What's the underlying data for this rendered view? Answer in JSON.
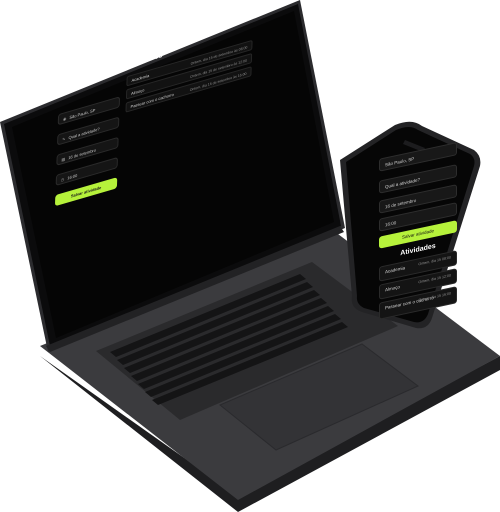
{
  "colors": {
    "accent": "#b6f23b",
    "device_body": "#3a3a3c",
    "screen": "#060606",
    "field": "#151515"
  },
  "laptop": {
    "form": {
      "location": "São Paulo, SP",
      "activity_placeholder": "Qual a atividade?",
      "date": "16 de setembro",
      "time": "16:00",
      "save_label": "Salvar atividade"
    },
    "panel": {
      "title": "Atividades",
      "items": [
        {
          "label": "Academia",
          "meta": "Ontem, dia 15 de setembro às 08:00"
        },
        {
          "label": "Almoço",
          "meta": "Ontem, dia 15 de setembro às 12:00"
        },
        {
          "label": "Passear com o cachorro",
          "meta": "Ontem, dia 15 de setembro às 16:00"
        }
      ]
    }
  },
  "phone": {
    "form": {
      "location": "São Paulo, SP",
      "activity_placeholder": "Qual a atividade?",
      "date": "16 de setembro",
      "time": "16:00",
      "save_label": "Salvar atividade"
    },
    "panel": {
      "title": "Atividades",
      "items": [
        {
          "label": "Academia",
          "meta": "Ontem, dia 15 08:00"
        },
        {
          "label": "Almoço",
          "meta": "Ontem, dia 15 12:00"
        },
        {
          "label": "Passear com o cachorro",
          "meta": "Ontem, dia 15 16:00"
        }
      ]
    }
  }
}
